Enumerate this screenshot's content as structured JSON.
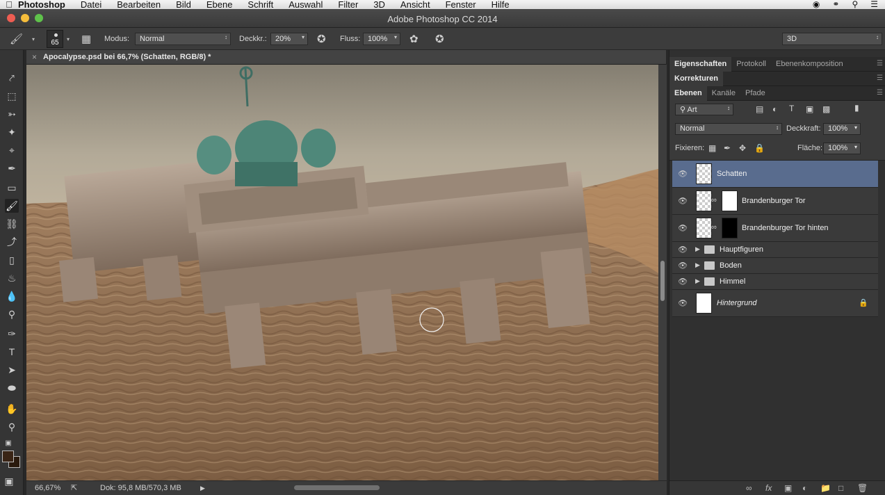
{
  "menubar": {
    "app": "Photoshop",
    "items": [
      "Datei",
      "Bearbeiten",
      "Bild",
      "Ebene",
      "Schrift",
      "Auswahl",
      "Filter",
      "3D",
      "Ansicht",
      "Fenster",
      "Hilfe"
    ]
  },
  "window": {
    "title": "Adobe Photoshop CC 2014"
  },
  "options": {
    "brush_size": "65",
    "modus_label": "Modus:",
    "modus_value": "Normal",
    "deckkr_label": "Deckkr.:",
    "deckkr_value": "20%",
    "fluss_label": "Fluss:",
    "fluss_value": "100%",
    "workspace": "3D"
  },
  "document": {
    "tab_title": "Apocalypse.psd bei 66,7% (Schatten, RGB/8) *"
  },
  "status": {
    "zoom": "66,67%",
    "doc_size": "Dok: 95,8 MB/570,3 MB"
  },
  "panels": {
    "group1_tabs": [
      "Eigenschaften",
      "Protokoll",
      "Ebenenkomposition"
    ],
    "group2_tabs": [
      "Korrekturen"
    ],
    "group3_tabs": [
      "Ebenen",
      "Kanäle",
      "Pfade"
    ],
    "filter_kind": "Art",
    "blend_mode": "Normal",
    "opacity_label": "Deckkraft:",
    "opacity_value": "100%",
    "lock_label": "Fixieren:",
    "fill_label": "Fläche:",
    "fill_value": "100%"
  },
  "layers": [
    {
      "name": "Schatten",
      "type": "pixel",
      "selected": true
    },
    {
      "name": "Brandenburger Tor",
      "type": "smart-mask-white"
    },
    {
      "name": "Brandenburger Tor hinten",
      "type": "smart-mask-black"
    },
    {
      "name": "Hauptfiguren",
      "type": "group"
    },
    {
      "name": "Boden",
      "type": "group"
    },
    {
      "name": "Himmel",
      "type": "group"
    },
    {
      "name": "Hintergrund",
      "type": "background",
      "locked": true
    }
  ],
  "colors": {
    "selected_layer": "#596c8e",
    "foreground_color": "#3a2516"
  }
}
